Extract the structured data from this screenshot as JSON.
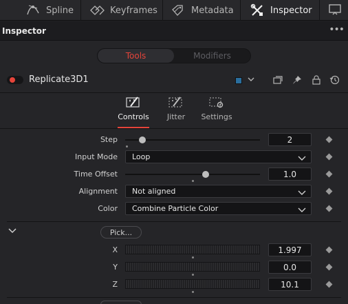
{
  "topbar": {
    "tabs": [
      {
        "label": "Spline",
        "icon": "spline-icon"
      },
      {
        "label": "Keyframes",
        "icon": "keyframes-icon"
      },
      {
        "label": "Metadata",
        "icon": "metadata-icon"
      },
      {
        "label": "Inspector",
        "icon": "inspector-icon",
        "active": true
      }
    ],
    "extra_icon": "monitor-icon"
  },
  "header": {
    "title": "Inspector",
    "more": "•••"
  },
  "segment": {
    "tools": "Tools",
    "modifiers": "Modifiers",
    "active": "Tools",
    "accent": "#e5443a"
  },
  "node": {
    "name": "Replicate3D1",
    "enabled": true,
    "color_chip": "#2a6e9e"
  },
  "subtabs": [
    {
      "label": "Controls",
      "icon": "controls-wand-icon",
      "active": true
    },
    {
      "label": "Jitter",
      "icon": "jitter-wand-icon"
    },
    {
      "label": "Settings",
      "icon": "settings-icon"
    }
  ],
  "params": {
    "step": {
      "label": "Step",
      "value": "2",
      "slider_fraction": 0.12
    },
    "input_mode": {
      "label": "Input Mode",
      "value": "Loop"
    },
    "time_offset": {
      "label": "Time Offset",
      "value": "1.0",
      "slider_fraction": 0.6
    },
    "alignment": {
      "label": "Alignment",
      "value": "Not aligned"
    },
    "color": {
      "label": "Color",
      "value": "Combine Particle Color"
    }
  },
  "offset": {
    "pick_label": "Pick...",
    "x": {
      "label": "X",
      "value": "1.997"
    },
    "y": {
      "label": "Y",
      "value": "0.0"
    },
    "z": {
      "label": "Z",
      "value": "10.1"
    }
  }
}
